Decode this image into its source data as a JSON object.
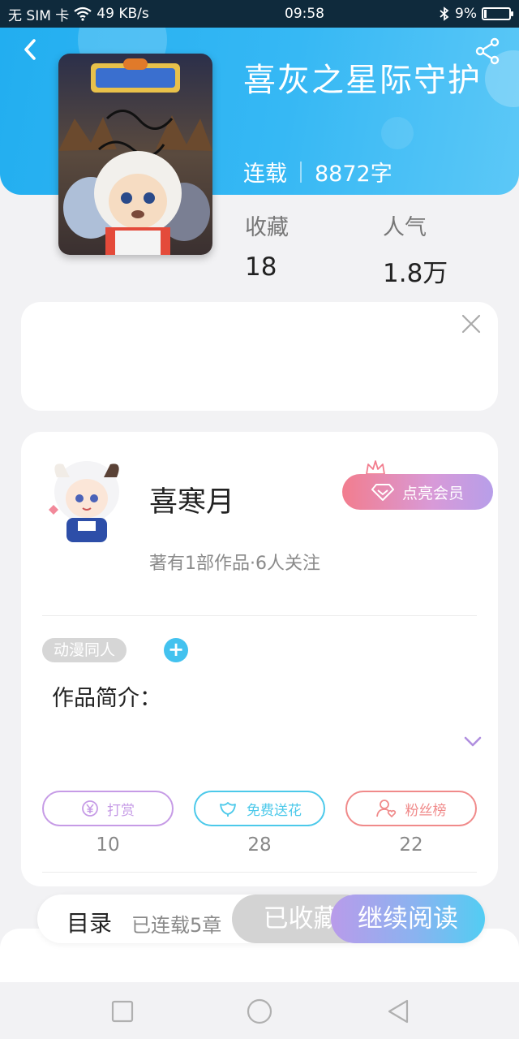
{
  "status_bar": {
    "carrier": "无 SIM 卡",
    "network_speed": "49 KB/s",
    "time": "09:58",
    "battery": "9%",
    "battery_level": 0.09
  },
  "book": {
    "title": "喜灰之星际守护",
    "status": "连载",
    "word_count": "8872字",
    "stats": [
      {
        "label": "收藏",
        "value": "18"
      },
      {
        "label": "人气",
        "value": "1.8万"
      }
    ]
  },
  "author": {
    "name": "喜寒月",
    "meta": "著有1部作品·6人关注",
    "vip_label": "点亮会员"
  },
  "tags": [
    "动漫同人"
  ],
  "tag_add": "+",
  "intro_title": "作品简介：",
  "actions": [
    {
      "label": "打赏",
      "count": "10",
      "color": "#c69be6",
      "icon": "yen-icon"
    },
    {
      "label": "免费送花",
      "count": "28",
      "color": "#4cc9ea",
      "icon": "flower-icon"
    },
    {
      "label": "粉丝榜",
      "count": "22",
      "color": "#f08a8a",
      "icon": "fan-icon"
    }
  ],
  "bottom_bar": {
    "toc_label": "目录",
    "toc_count": "已连载5章",
    "favorite_label": "已收藏",
    "read_label": "继续阅读"
  },
  "colors": {
    "header_blue": "#2bb2f2",
    "accent_cyan": "#43c2ef",
    "vip_pink": "#f27d8e",
    "vip_purple": "#b79ee9"
  }
}
